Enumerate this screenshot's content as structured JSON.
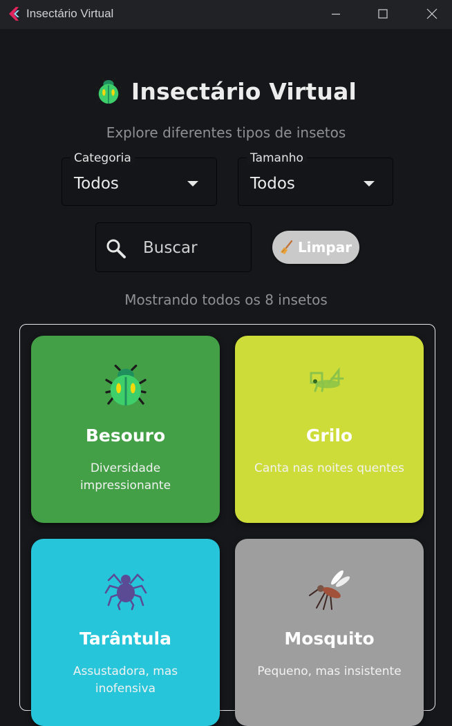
{
  "window": {
    "title": "Insectário Virtual"
  },
  "header": {
    "title": "Insectário Virtual",
    "subtitle": "Explore diferentes tipos de insetos",
    "icon": "beetle-icon"
  },
  "filters": {
    "category": {
      "label": "Categoria",
      "value": "Todos"
    },
    "size": {
      "label": "Tamanho",
      "value": "Todos"
    }
  },
  "search": {
    "placeholder": "Buscar",
    "value": ""
  },
  "clear_button": {
    "label": "Limpar",
    "icon": "broom-icon"
  },
  "status": {
    "count_text": "Mostrando todos os 8 insetos"
  },
  "cards": [
    {
      "name": "Besouro",
      "description": "Diversidade impressionante",
      "icon": "beetle-icon",
      "color": "#43a046"
    },
    {
      "name": "Grilo",
      "description": "Canta nas noites quentes",
      "icon": "cricket-icon",
      "color": "#cddc38"
    },
    {
      "name": "Tarântula",
      "description": "Assustadora, mas inofensiva",
      "icon": "spider-icon",
      "color": "#26c5da"
    },
    {
      "name": "Mosquito",
      "description": "Pequeno, mas insistente",
      "icon": "mosquito-icon",
      "color": "#9e9e9e"
    }
  ]
}
